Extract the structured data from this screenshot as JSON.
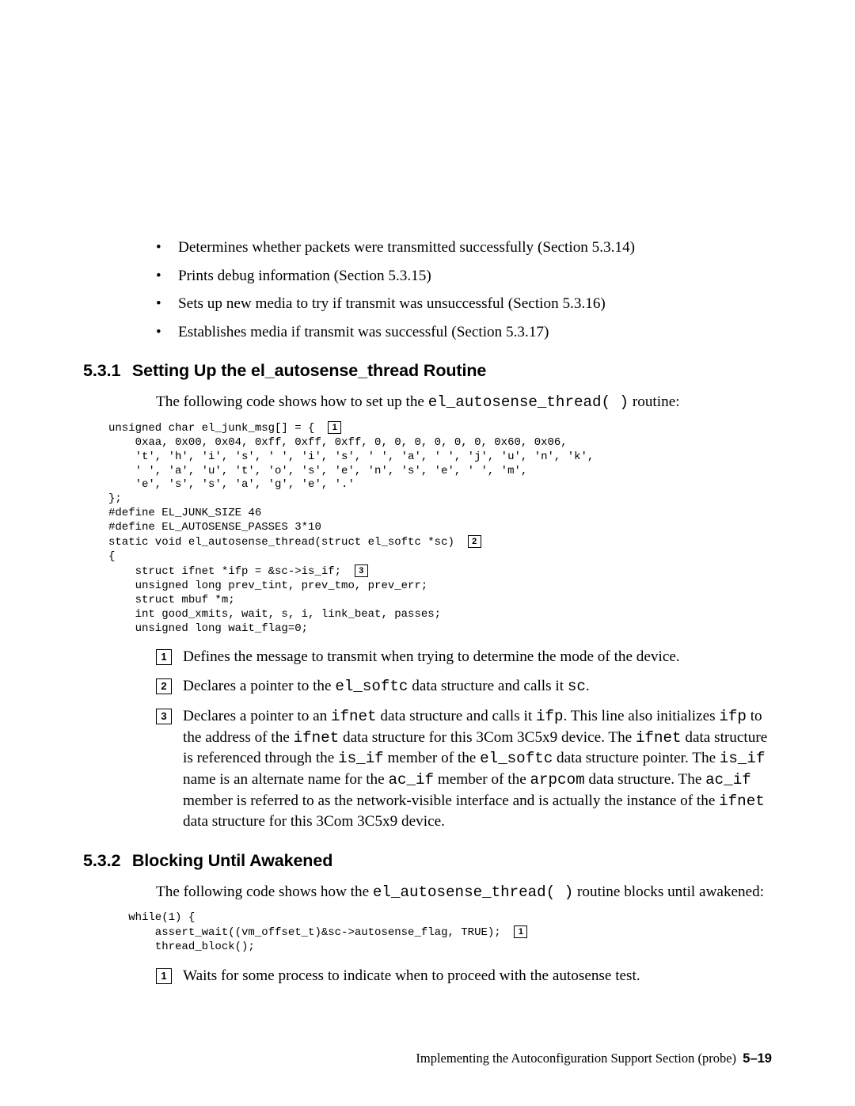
{
  "top_bullets": [
    "Determines whether packets were transmitted successfully (Section 5.3.14)",
    "Prints debug information (Section 5.3.15)",
    "Sets up new media to try if transmit was unsuccessful (Section 5.3.16)",
    "Establishes media if transmit was successful (Section 5.3.17)"
  ],
  "s531": {
    "num": "5.3.1",
    "title": "Setting Up the el_autosense_thread Routine",
    "intro_pre": "The following code shows how to set up the ",
    "intro_code": "el_autosense_thread( )",
    "intro_post": " routine:",
    "code": {
      "l1a": "unsigned char el_junk_msg[] = {  ",
      "l2": "    0xaa, 0x00, 0x04, 0xff, 0xff, 0xff, 0, 0, 0, 0, 0, 0, 0x60, 0x06,",
      "l3": "    't', 'h', 'i', 's', ' ', 'i', 's', ' ', 'a', ' ', 'j', 'u', 'n', 'k',",
      "l4": "    ' ', 'a', 'u', 't', 'o', 's', 'e', 'n', 's', 'e', ' ', 'm',",
      "l5": "    'e', 's', 's', 'a', 'g', 'e', '.'",
      "l6": "};",
      "l7": "#define EL_JUNK_SIZE 46",
      "l8": "#define EL_AUTOSENSE_PASSES 3*10",
      "l9a": "static void el_autosense_thread(struct el_softc *sc)  ",
      "l10": "{",
      "l11a": "    struct ifnet *ifp = &sc->is_if;  ",
      "l12": "    unsigned long prev_tint, prev_tmo, prev_err;",
      "l13": "    struct mbuf *m;",
      "l14": "    int good_xmits, wait, s, i, link_beat, passes;",
      "l15": "    unsigned long wait_flag=0;"
    },
    "notes": {
      "n1": "Defines the message to transmit when trying to determine the mode of the device.",
      "n2_pre": "Declares a pointer to the ",
      "n2_c1": "el_softc",
      "n2_mid": " data structure and calls it ",
      "n2_c2": "sc",
      "n2_post": ".",
      "n3_a": "Declares a pointer to an ",
      "n3_c1": "ifnet",
      "n3_b": " data structure and calls it ",
      "n3_c2": "ifp",
      "n3_c": ". This line also initializes ",
      "n3_c3": "ifp",
      "n3_d": " to the address of the ",
      "n3_c4": "ifnet",
      "n3_e": " data structure for this 3Com 3C5x9 device. The ",
      "n3_c5": "ifnet",
      "n3_f": " data structure is referenced through the ",
      "n3_c6": "is_if",
      "n3_g": " member of the ",
      "n3_c7": "el_softc",
      "n3_h": " data structure pointer. The ",
      "n3_c8": "is_if",
      "n3_i": " name is an alternate name for the ",
      "n3_c9": "ac_if",
      "n3_j": " member of the ",
      "n3_c10": "arpcom",
      "n3_k": " data structure. The ",
      "n3_c11": "ac_if",
      "n3_l": " member is referred to as the network-visible interface and is actually the instance of the ",
      "n3_c12": "ifnet",
      "n3_m": " data structure for this 3Com 3C5x9 device."
    }
  },
  "s532": {
    "num": "5.3.2",
    "title": "Blocking Until Awakened",
    "intro_pre": "The following code shows how the ",
    "intro_code": "el_autosense_thread( )",
    "intro_post": " routine blocks until awakened:",
    "code": {
      "l1": "   while(1) {",
      "l2a": "       assert_wait((vm_offset_t)&sc->autosense_flag, TRUE);  ",
      "l3": "       thread_block();"
    },
    "notes": {
      "n1": "Waits for some process to indicate when to proceed with the autosense test."
    }
  },
  "footer": {
    "text": "Implementing the Autoconfiguration Support Section (probe)",
    "page": "5–19"
  },
  "callouts": {
    "one": "1",
    "two": "2",
    "three": "3"
  }
}
